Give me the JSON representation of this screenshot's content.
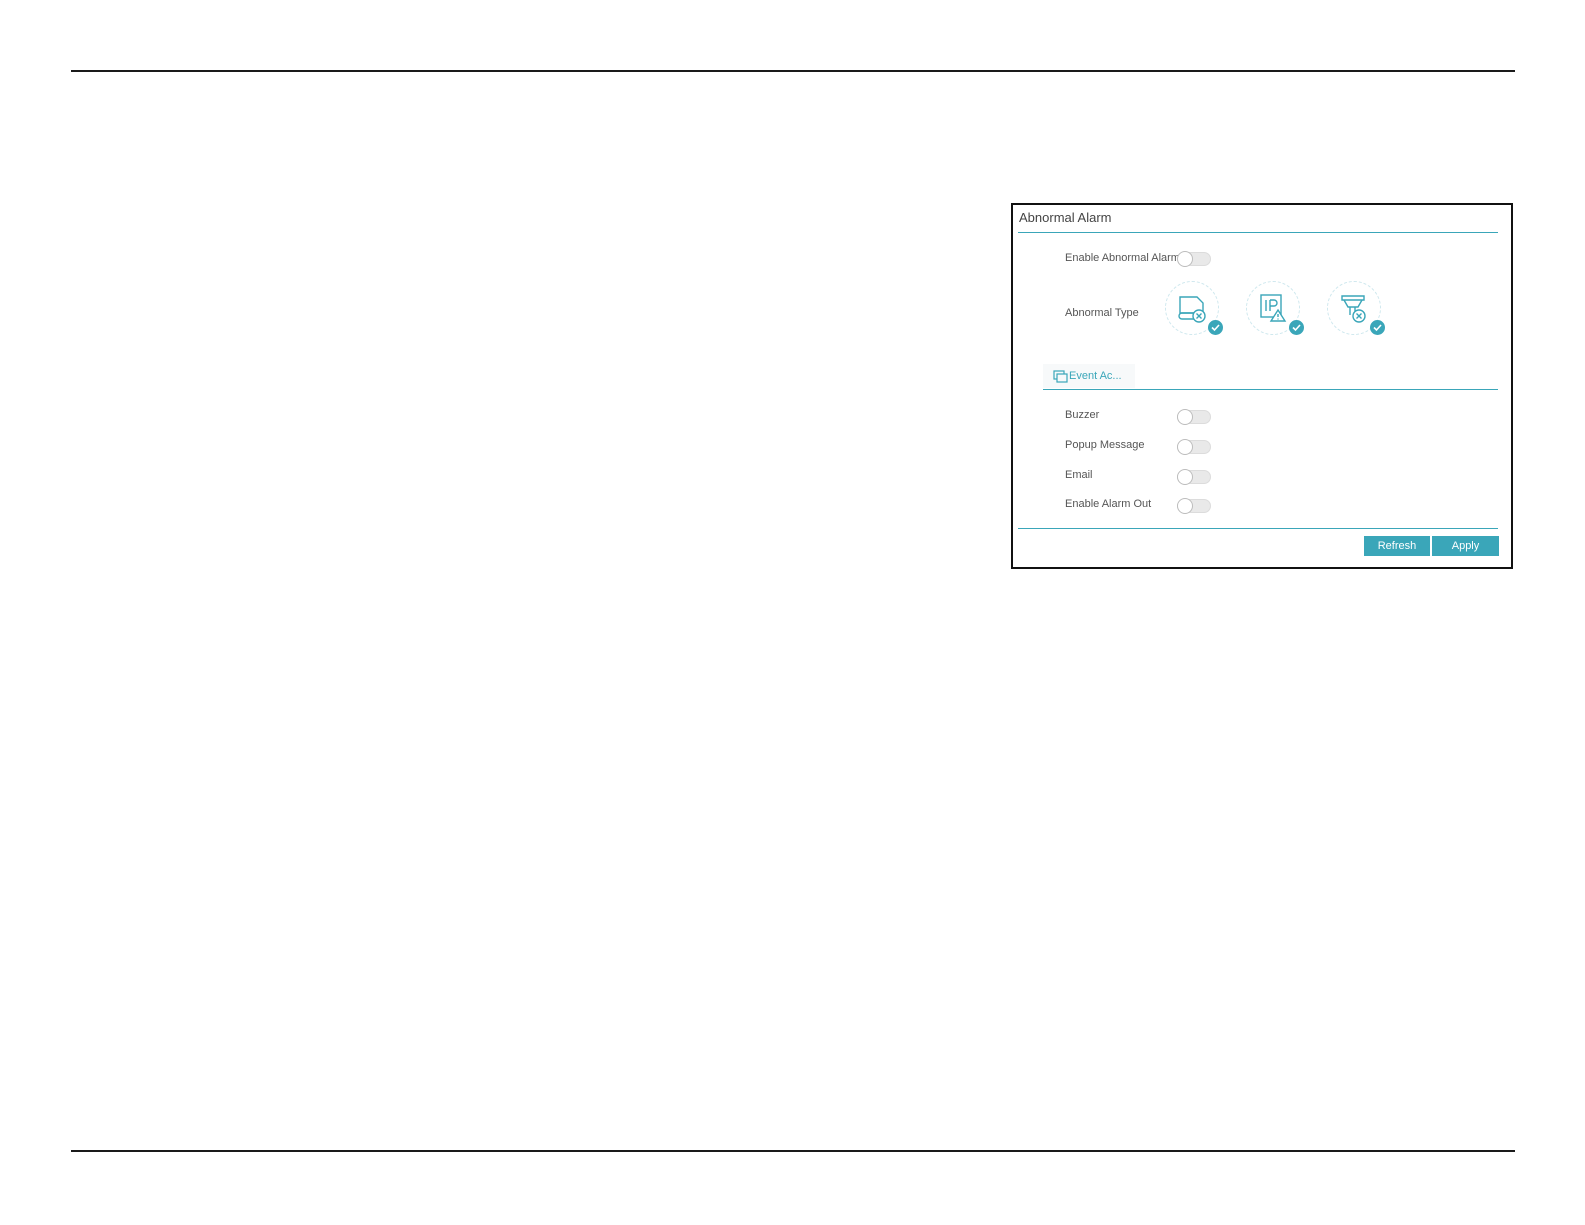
{
  "panel": {
    "title": "Abnormal Alarm",
    "enable_label": "Enable Abnormal Alarm",
    "type_label": "Abnormal Type",
    "abnormal_types": [
      {
        "icon": "disk-error-icon",
        "checked": true
      },
      {
        "icon": "ip-conflict-icon",
        "checked": true
      },
      {
        "icon": "network-disconnected-icon",
        "checked": true
      }
    ],
    "tab_label": "Event Ac...",
    "tab_icon": "event-action-icon",
    "actions": [
      {
        "label": "Buzzer",
        "enabled": false
      },
      {
        "label": "Popup Message",
        "enabled": false
      },
      {
        "label": "Email",
        "enabled": false
      },
      {
        "label": "Enable Alarm Out",
        "enabled": false
      }
    ],
    "buttons": {
      "refresh": "Refresh",
      "apply": "Apply"
    },
    "accent_color": "#3aa6b9"
  }
}
